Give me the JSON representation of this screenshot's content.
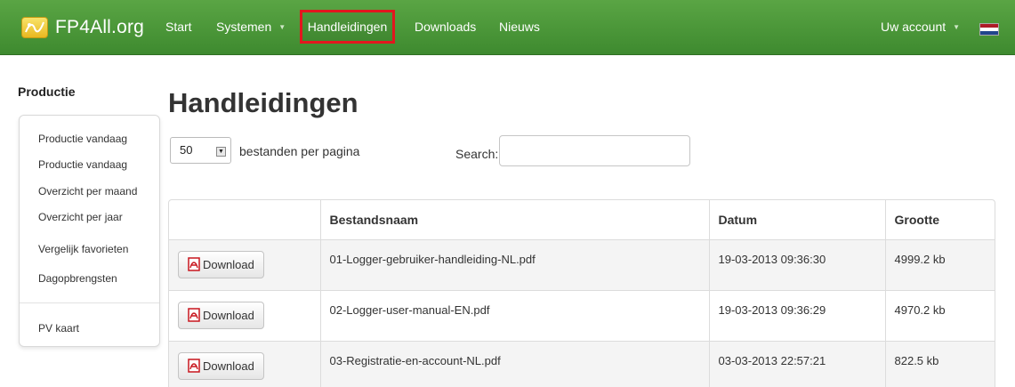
{
  "brand": {
    "name": "FP4All.org"
  },
  "nav": {
    "items": [
      {
        "label": "Start"
      },
      {
        "label": "Systemen",
        "caret": "▼"
      },
      {
        "label": "Handleidingen"
      },
      {
        "label": "Downloads"
      },
      {
        "label": "Nieuws"
      }
    ],
    "account": {
      "label": "Uw account",
      "caret": "▼"
    },
    "flag_colors": [
      "#ae1c28",
      "#ffffff",
      "#21468b"
    ]
  },
  "sidebar": {
    "title": "Productie",
    "items": [
      {
        "label": "Productie vandaag"
      },
      {
        "label": "Productie vandaag"
      },
      {
        "label": "Overzicht per maand"
      },
      {
        "label": "Overzicht per jaar"
      },
      {
        "label": "Vergelijk favorieten"
      },
      {
        "label": "Dagopbrengsten"
      },
      {
        "label": "PV kaart"
      }
    ]
  },
  "main": {
    "title": "Handleidingen",
    "page_size": {
      "value": "50",
      "arrow": "▼",
      "label": "bestanden per pagina"
    },
    "search": {
      "label": "Search:",
      "value": "",
      "placeholder": ""
    },
    "table": {
      "headers": [
        "",
        "Bestandsnaam",
        "Datum",
        "Grootte"
      ],
      "rows": [
        {
          "button": "Download",
          "name": "01-Logger-gebruiker-handleiding-NL.pdf",
          "date": "19-03-2013 09:36:30",
          "size": "4999.2 kb"
        },
        {
          "button": "Download",
          "name": "02-Logger-user-manual-EN.pdf",
          "date": "19-03-2013 09:36:29",
          "size": "4970.2 kb"
        },
        {
          "button": "Download",
          "name": "03-Registratie-en-account-NL.pdf",
          "date": "03-03-2013 22:57:21",
          "size": "822.5 kb"
        }
      ]
    }
  },
  "colors": {
    "navbar": "#4b9a39",
    "highlight": "#e3161e",
    "pdf_red": "#c8161e"
  }
}
